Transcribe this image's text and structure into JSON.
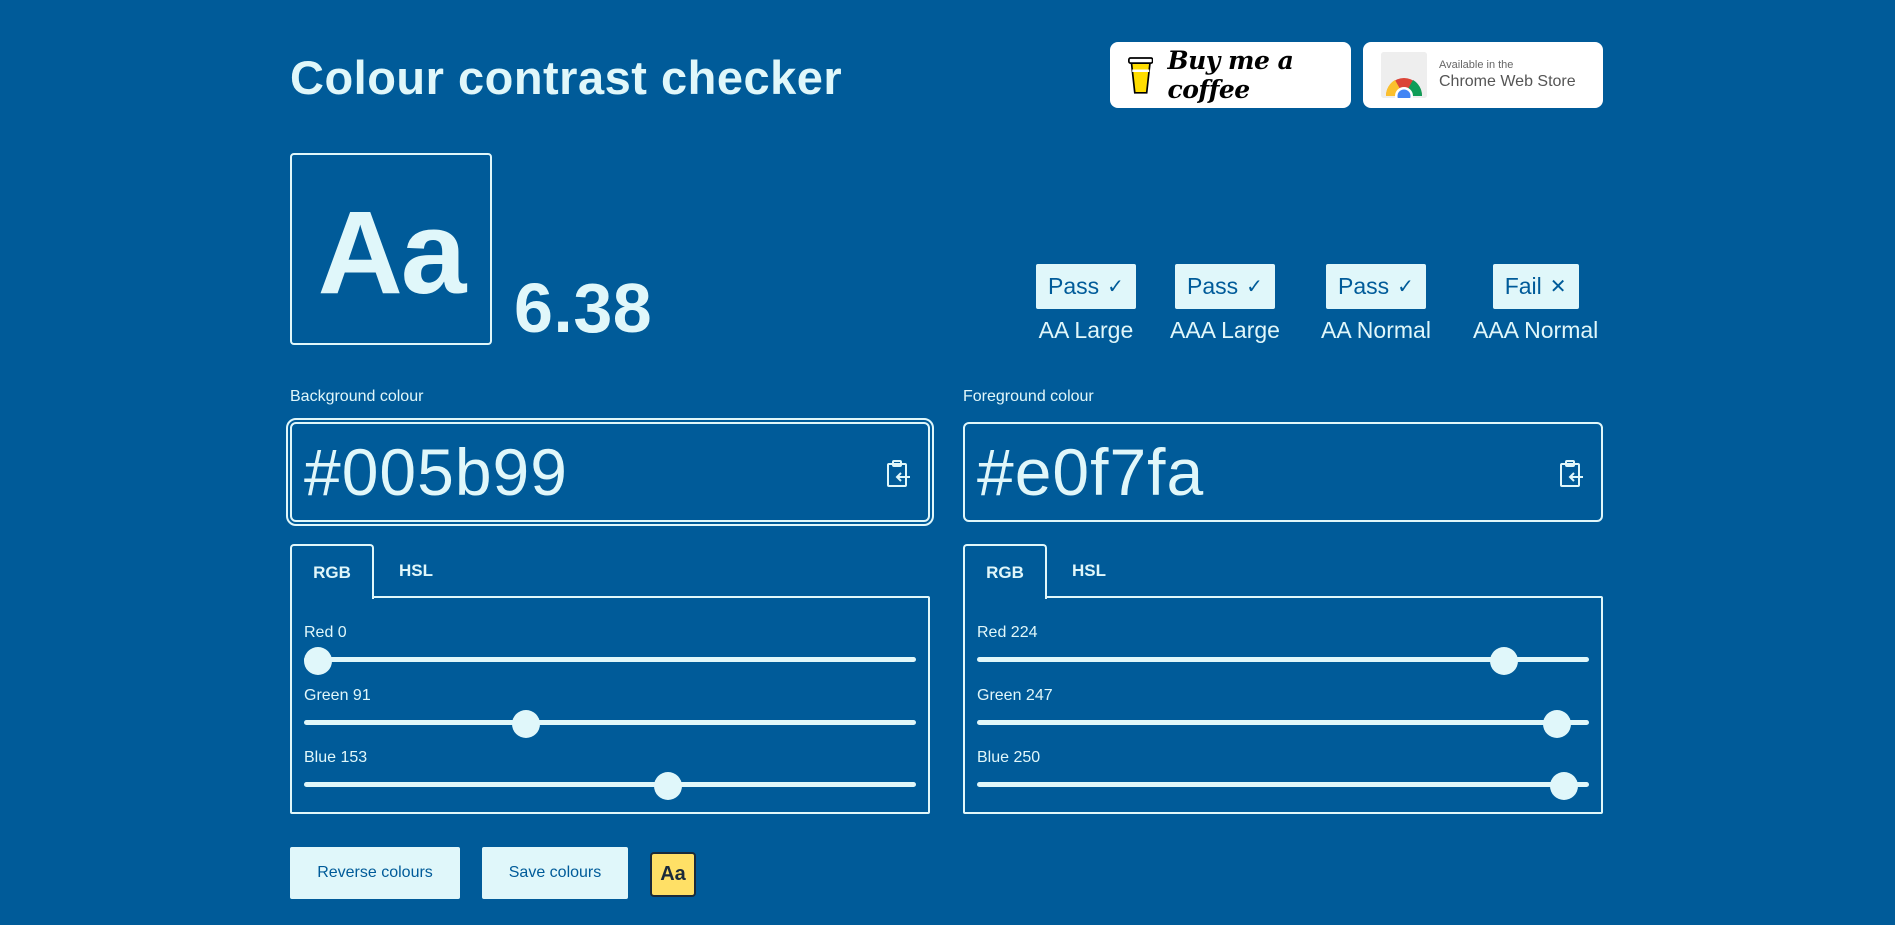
{
  "header": {
    "title": "Colour contrast checker",
    "buy_coffee_label": "Buy me a coffee",
    "chrome_store_small": "Available in the",
    "chrome_store_big": "Chrome Web Store"
  },
  "preview": {
    "sample_text": "Aa",
    "contrast_ratio": "6.38"
  },
  "results": [
    {
      "status": "Pass",
      "mark": "✓",
      "label": "AA Large"
    },
    {
      "status": "Pass",
      "mark": "✓",
      "label": "AAA Large"
    },
    {
      "status": "Pass",
      "mark": "✓",
      "label": "AA Normal"
    },
    {
      "status": "Fail",
      "mark": "✕",
      "label": "AAA Normal"
    }
  ],
  "background": {
    "label": "Background colour",
    "value": "#005b99",
    "tabs": [
      "RGB",
      "HSL"
    ],
    "active_tab": "RGB",
    "sliders": [
      {
        "label": "Red 0",
        "value": 0,
        "max": 255
      },
      {
        "label": "Green 91",
        "value": 91,
        "max": 255
      },
      {
        "label": "Blue 153",
        "value": 153,
        "max": 255
      }
    ]
  },
  "foreground": {
    "label": "Foreground colour",
    "value": "#e0f7fa",
    "tabs": [
      "RGB",
      "HSL"
    ],
    "active_tab": "RGB",
    "sliders": [
      {
        "label": "Red 224",
        "value": 224,
        "max": 255
      },
      {
        "label": "Green 247",
        "value": 247,
        "max": 255
      },
      {
        "label": "Blue 250",
        "value": 250,
        "max": 255
      }
    ]
  },
  "actions": {
    "reverse_label": "Reverse colours",
    "save_label": "Save colours",
    "aa_label": "Aa"
  },
  "colors": {
    "background": "#005b99",
    "foreground": "#e0f7fa",
    "aa_button": "#ffe066"
  }
}
